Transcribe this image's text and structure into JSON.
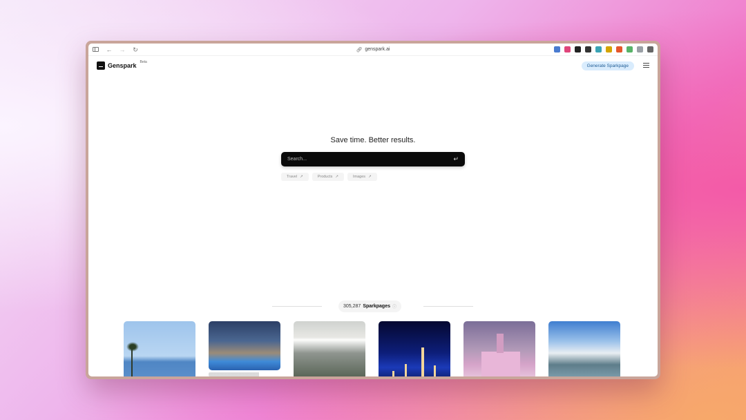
{
  "browser": {
    "url": "genspark.ai",
    "extension_colors": [
      "#4a7bd0",
      "#e0457b",
      "#222222",
      "#333333",
      "#3aa3b5",
      "#d4a400",
      "#e5572b",
      "#58b368",
      "#9aa0a6",
      "#666666"
    ]
  },
  "header": {
    "brand": "Genspark",
    "beta": "Beta",
    "cta": "Generate Sparkpage"
  },
  "main": {
    "tagline": "Save time. Better results.",
    "search_placeholder": "Search...",
    "chips": [
      {
        "label": "Travel",
        "icon": "↗"
      },
      {
        "label": "Products",
        "icon": "↗"
      },
      {
        "label": "Images",
        "icon": "↗"
      }
    ]
  },
  "sparkpages": {
    "count": "305,287",
    "label": "Sparkpages"
  }
}
